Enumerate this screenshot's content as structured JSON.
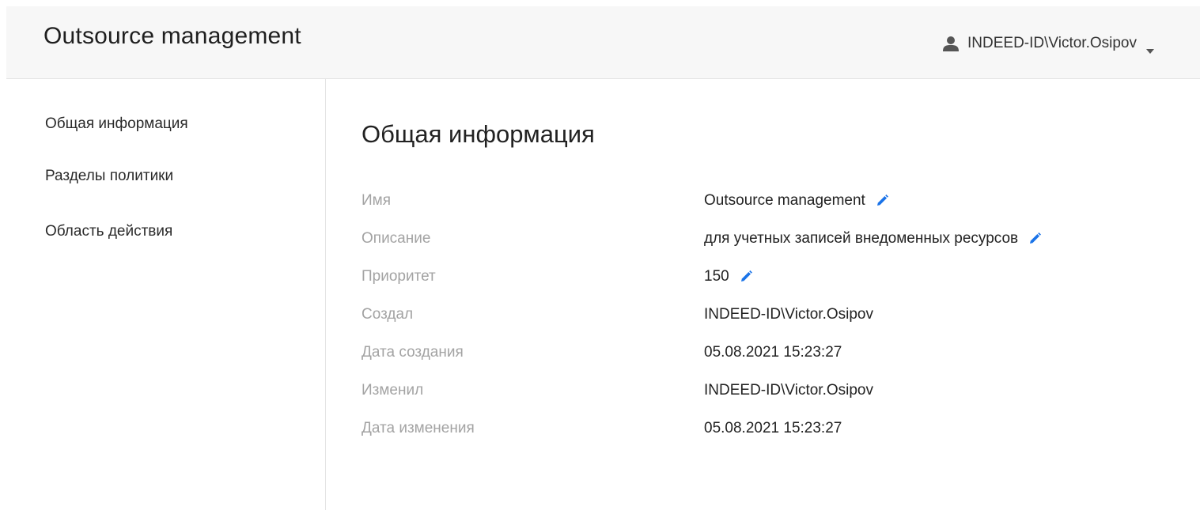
{
  "header": {
    "app_title": "Outsource management",
    "user_name": "INDEED-ID\\Victor.Osipov",
    "user_icon": "user-icon",
    "caret_icon": "caret-down-icon"
  },
  "sidebar": {
    "items": [
      {
        "label": "Общая информация",
        "active": true
      },
      {
        "label": "Разделы политики",
        "active": false
      },
      {
        "label": "Область действия",
        "active": false
      }
    ]
  },
  "main": {
    "title": "Общая информация",
    "fields": [
      {
        "label": "Имя",
        "value": "Outsource management",
        "editable": true
      },
      {
        "label": "Описание",
        "value": "для учетных записей внедоменных ресурсов",
        "editable": true
      },
      {
        "label": "Приоритет",
        "value": "150",
        "editable": true
      },
      {
        "label": "Создал",
        "value": "INDEED-ID\\Victor.Osipov",
        "editable": false
      },
      {
        "label": "Дата создания",
        "value": "05.08.2021 15:23:27",
        "editable": false
      },
      {
        "label": "Изменил",
        "value": "INDEED-ID\\Victor.Osipov",
        "editable": false
      },
      {
        "label": "Дата изменения",
        "value": "05.08.2021 15:23:27",
        "editable": false
      }
    ],
    "edit_icon": "pencil-icon"
  },
  "colors": {
    "header_bg": "#f7f7f7",
    "label_gray": "#a3a3a3",
    "text_dark": "#222222",
    "edit_icon_blue": "#1a73e8",
    "divider": "#e4e4e4"
  }
}
